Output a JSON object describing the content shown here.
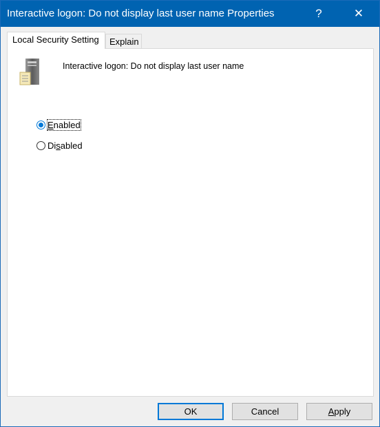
{
  "window": {
    "title": "Interactive logon: Do not display last user name Properties",
    "help_label": "?",
    "close_label": "✕"
  },
  "tabs": [
    {
      "label": "Local Security Setting",
      "active": true
    },
    {
      "label": "Explain",
      "active": false
    }
  ],
  "panel": {
    "icon": "server-policy-icon",
    "policy_name": "Interactive logon: Do not display last user name"
  },
  "options": [
    {
      "label_pre": "",
      "label_key": "E",
      "label_post": "nabled",
      "selected": true
    },
    {
      "label_pre": "Di",
      "label_key": "s",
      "label_post": "abled",
      "selected": false
    }
  ],
  "buttons": {
    "ok": "OK",
    "cancel": "Cancel",
    "apply_key": "A",
    "apply_rest": "pply"
  },
  "colors": {
    "titlebar": "#0063b1",
    "accent": "#0078d7"
  }
}
